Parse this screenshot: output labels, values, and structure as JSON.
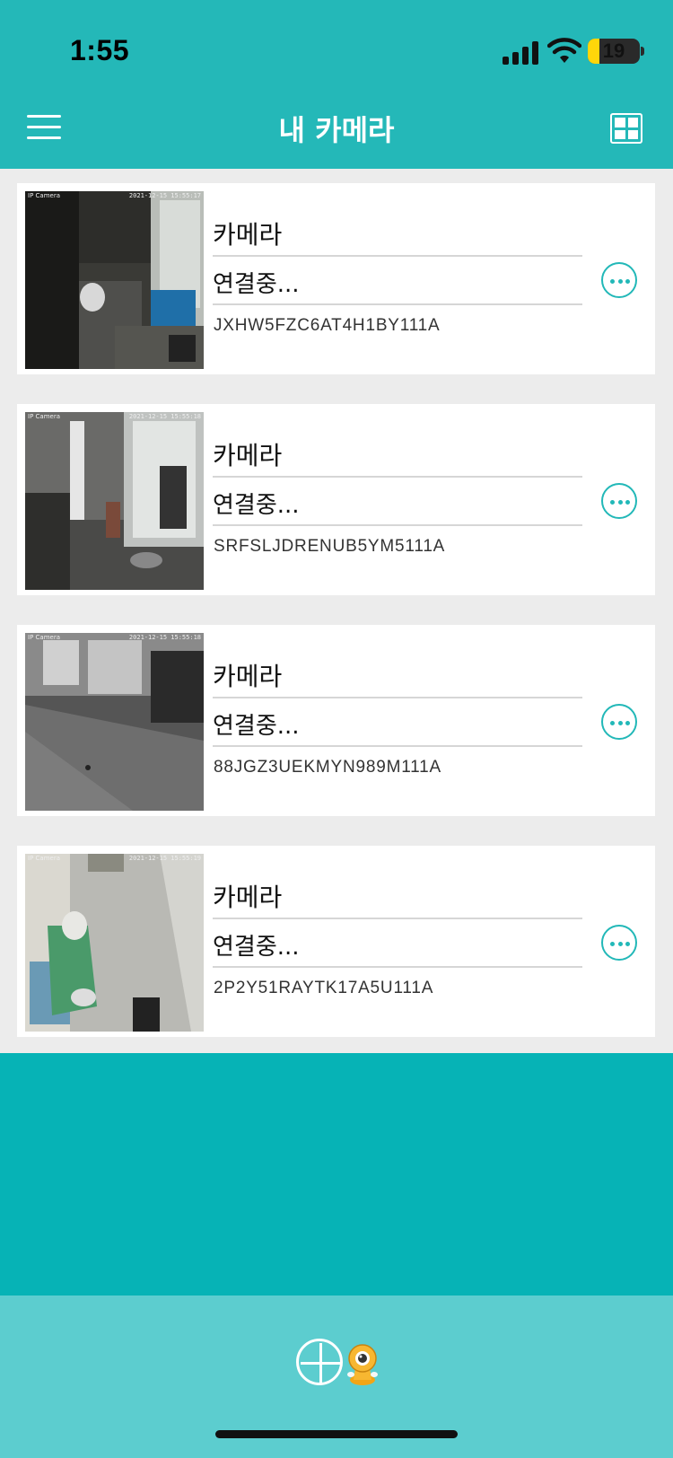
{
  "status_bar": {
    "time": "1:55",
    "battery_level": "19"
  },
  "header": {
    "title": "내 카메라",
    "menu_icon": "hamburger-menu-icon",
    "view_icon": "grid-view-icon"
  },
  "cameras": [
    {
      "name": "카메라",
      "status": "연결중...",
      "id": "JXHW5FZC6AT4H1BY111A"
    },
    {
      "name": "카메라",
      "status": "연결중...",
      "id": "SRFSLJDRENUB5YM5111A"
    },
    {
      "name": "카메라",
      "status": "연결중...",
      "id": "88JGZ3UEKMYN989M111A"
    },
    {
      "name": "카메라",
      "status": "연결중...",
      "id": "2P2Y51RAYTK17A5U111A"
    }
  ],
  "colors": {
    "brand": "#24b8b8",
    "background": "#06b3b6",
    "list_bg": "#ececec",
    "bottom_bar": "#5ccdcf"
  }
}
